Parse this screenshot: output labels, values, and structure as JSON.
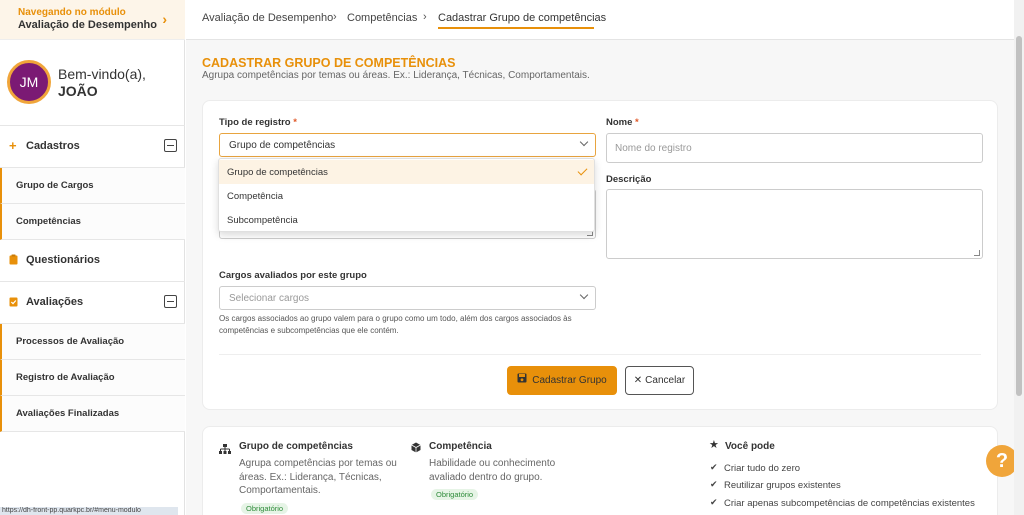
{
  "sidebar": {
    "module_label": "Navegando no módulo",
    "module_name": "Avaliação de Desempenho",
    "avatar_initials": "JM",
    "welcome": "Bem-vindo(a),",
    "user_name": "JOÃO",
    "sections": {
      "cadastros": {
        "label": "Cadastros",
        "items": [
          "Grupo de Cargos",
          "Competências"
        ]
      },
      "questionarios": {
        "label": "Questionários"
      },
      "avaliacoes": {
        "label": "Avaliações",
        "items": [
          "Processos de Avaliação",
          "Registro de Avaliação",
          "Avaliações Finalizadas"
        ]
      }
    },
    "status_url": "https://dh-front-pp.quarkpc.br/#menu-modulo"
  },
  "breadcrumb": [
    "Avaliação de Desempenho",
    "Competências",
    "Cadastrar Grupo de competências"
  ],
  "page": {
    "title": "CADASTRAR GRUPO DE COMPETÊNCIAS",
    "subtitle": "Agrupa competências por temas ou áreas. Ex.: Liderança, Técnicas, Comportamentais."
  },
  "form": {
    "tipo_label": "Tipo de registro",
    "tipo_value": "Grupo de competências",
    "tipo_options": [
      "Grupo de competências",
      "Competência",
      "Subcompetência"
    ],
    "nome_label": "Nome",
    "nome_placeholder": "Nome do registro",
    "descricao_label": "Descrição",
    "cargos_label": "Cargos avaliados por este grupo",
    "cargos_placeholder": "Selecionar cargos",
    "help_text": "Os cargos associados ao grupo valem para o grupo como um todo, além dos cargos associados às competências e subcompetências que ele contém.",
    "required_mark": "*",
    "submit_label": "Cadastrar Grupo",
    "cancel_label": "Cancelar"
  },
  "info": {
    "grupo": {
      "title": "Grupo de competências",
      "text": "Agrupa competências por temas ou áreas. Ex.: Liderança, Técnicas, Comportamentais.",
      "badge": "Obrigatório"
    },
    "competencia": {
      "title": "Competência",
      "text": "Habilidade ou conhecimento avaliado dentro do grupo.",
      "badge": "Obrigatório"
    },
    "voce_pode": {
      "title": "Você pode",
      "items": [
        "Criar tudo do zero",
        "Reutilizar grupos existentes",
        "Criar apenas subcompetências de competências existentes"
      ]
    }
  },
  "colors": {
    "accent": "#e8900a",
    "avatar": "#7b1a74"
  },
  "icons": {
    "module": "chevron-right-icon",
    "cadastros": "plus-icon",
    "questionarios": "clipboard-icon",
    "avaliacoes": "clipboard-check-icon",
    "submit": "save-icon",
    "cancel": "x-icon",
    "grupo": "sitemap-icon",
    "competencia": "cube-icon",
    "voce_pode": "star-icon",
    "help": "question-icon"
  }
}
